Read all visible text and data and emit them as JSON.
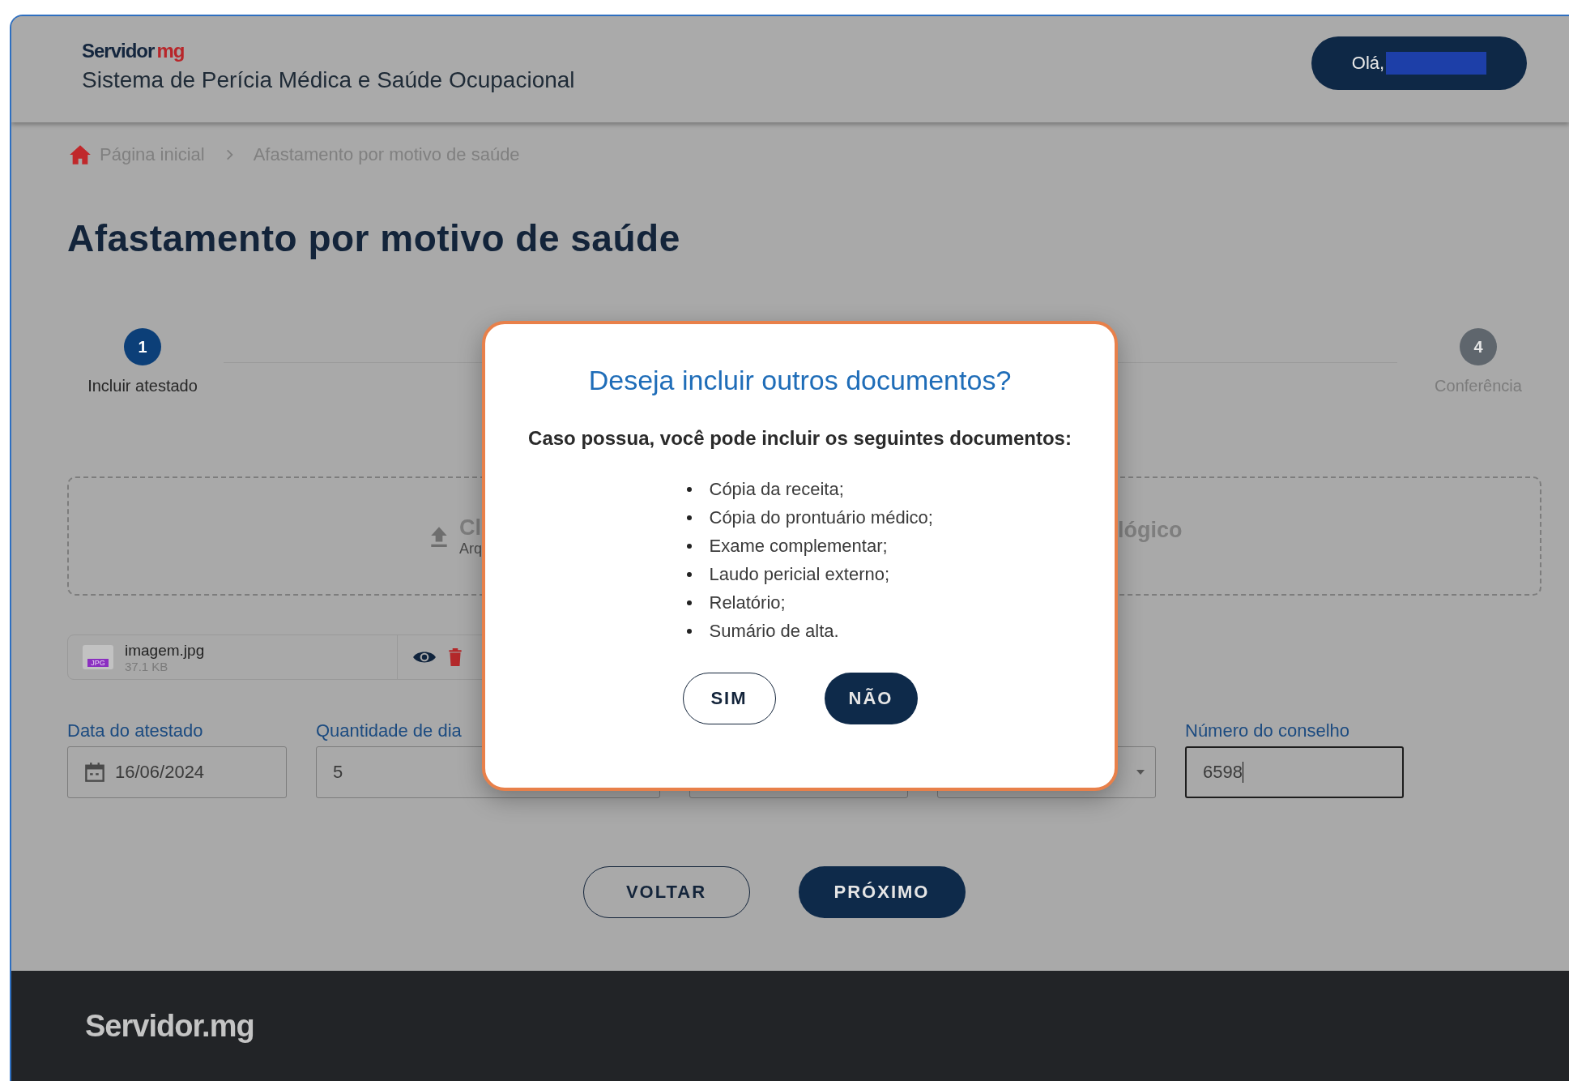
{
  "header": {
    "logo": {
      "main": "Servidor",
      "suffix": "mg"
    },
    "title": "Sistema de Perícia Médica e Saúde Ocupacional",
    "greeting": "Olá,"
  },
  "breadcrumb": [
    "Página inicial",
    "Afastamento por motivo de saúde"
  ],
  "page_title": "Afastamento por motivo de saúde",
  "stepper": [
    {
      "number": "1",
      "label": "Incluir atestado",
      "selected": true
    },
    {
      "number": "4",
      "label": "Conferência",
      "selected": false
    }
  ],
  "upload": {
    "title_start": "Cl",
    "hint_start": "Arq",
    "title_end": "lógico"
  },
  "file": {
    "badge": "JPG",
    "name": "imagem.jpg",
    "size": "37.1 KB"
  },
  "fields": [
    {
      "kind": "date",
      "label": "Data do atestado",
      "value": "16/06/2024",
      "focused": false
    },
    {
      "kind": "text",
      "label": "Quantidade de dia",
      "value": "5",
      "focused": false
    },
    {
      "kind": "blank"
    },
    {
      "kind": "select"
    },
    {
      "kind": "text",
      "label": "Número do conselho",
      "value": "6598",
      "focused": true
    }
  ],
  "buttons": [
    {
      "label": "VOLTAR",
      "kind": "outline"
    },
    {
      "label": "PRÓXIMO",
      "kind": "filled"
    }
  ],
  "footer": {
    "logo": "Servidor.mg"
  },
  "dialog": {
    "title": "Deseja incluir outros documentos?",
    "subtitle": "Caso possua, você pode incluir os seguintes documentos:",
    "items": [
      "Cópia da receita;",
      "Cópia do prontuário médico;",
      "Exame complementar;",
      "Laudo pericial externo;",
      "Relatório;",
      "Sumário de alta."
    ],
    "buttons": [
      {
        "label": "SIM",
        "kind": "outline"
      },
      {
        "label": "NÃO",
        "kind": "filled"
      }
    ]
  }
}
